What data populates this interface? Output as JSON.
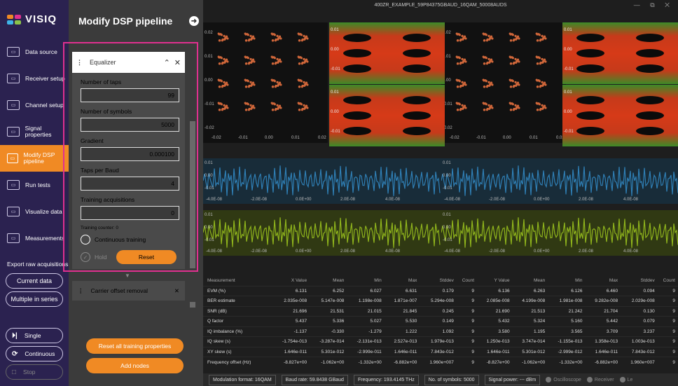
{
  "app": {
    "logo": "VISIQ",
    "window_title": "400ZR_EXAMPLE_59P84375GBAUD_16QAM_50008AUDS"
  },
  "colors": {
    "accent": "#f08a24",
    "nav_bg": "#2b2250",
    "highlight": "#e0308f"
  },
  "nav": {
    "items": [
      {
        "label": "Data source",
        "icon": "data-source-icon"
      },
      {
        "label": "Receiver setup",
        "icon": "receiver-icon"
      },
      {
        "label": "Channel setup",
        "icon": "channel-icon"
      },
      {
        "label": "Signal properties",
        "icon": "signal-icon"
      },
      {
        "label": "Modify DSP pipeline",
        "icon": "dsp-icon"
      },
      {
        "label": "Run tests",
        "icon": "run-tests-icon"
      },
      {
        "label": "Visualize data",
        "icon": "visualize-icon"
      },
      {
        "label": "Measurements",
        "icon": "measurements-icon"
      }
    ],
    "export_label": "Export raw acquisitions",
    "current_data": "Current data",
    "multiple_series": "Multiple in series",
    "single": "Single",
    "continuous": "Continuous",
    "stop": "Stop"
  },
  "panel": {
    "title": "Modify DSP pipeline",
    "equalizer": {
      "title": "Equalizer",
      "fields": [
        {
          "label": "Number of taps",
          "value": "99"
        },
        {
          "label": "Number of symbols",
          "value": "5000"
        },
        {
          "label": "Gradient",
          "value": "0.000100"
        },
        {
          "label": "Taps per Baud",
          "value": "4"
        },
        {
          "label": "Training acquisitions",
          "value": "0"
        }
      ],
      "training_counter": "Training counter: 0",
      "continuous_training": "Continuous training",
      "hold": "Hold",
      "reset": "Reset"
    },
    "carrier": {
      "title": "Carrier offset removal"
    },
    "reset_all": "Reset all training properties",
    "add_nodes": "Add nodes"
  },
  "plots": {
    "const_x_ticks": [
      "-0.02",
      "-0.01",
      "0.00",
      "0.01",
      "0.02"
    ],
    "const_y_ticks": [
      "0.02",
      "0.01",
      "0.00",
      "-0.01",
      "-0.02"
    ],
    "eye_ticks": [
      "0.01",
      "0.00",
      "-0.01"
    ],
    "time_ticks": [
      "-4.0E-08",
      "-2.0E-08",
      "0.0E+00",
      "2.0E-08",
      "4.0E-08"
    ]
  },
  "measurements": {
    "headers": [
      "Measurement",
      "X Value",
      "Mean",
      "Min",
      "Max",
      "Stddev",
      "Count",
      "Y Value",
      "Mean",
      "Min",
      "Max",
      "Stddev",
      "Count"
    ],
    "rows": [
      [
        "EVM (%)",
        "6.131",
        "6.252",
        "6.027",
        "6.631",
        "0.179",
        "9",
        "6.136",
        "6.263",
        "6.126",
        "6.460",
        "0.094",
        "9"
      ],
      [
        "BER estimate",
        "2.035e-008",
        "5.147e-008",
        "1.198e-008",
        "1.871e-007",
        "5.294e-008",
        "9",
        "2.085e-008",
        "4.199e-008",
        "1.981e-008",
        "9.282e-008",
        "2.029e-008",
        "9"
      ],
      [
        "SNR (dB)",
        "21.696",
        "21.531",
        "21.015",
        "21.845",
        "0.245",
        "9",
        "21.690",
        "21.513",
        "21.242",
        "21.704",
        "0.130",
        "9"
      ],
      [
        "Q factor",
        "5.437",
        "5.336",
        "5.027",
        "5.530",
        "0.149",
        "9",
        "5.432",
        "5.324",
        "5.160",
        "5.442",
        "0.079",
        "9"
      ],
      [
        "IQ imbalance (%)",
        "-1.137",
        "-0.330",
        "-1.279",
        "1.222",
        "1.092",
        "9",
        "3.580",
        "1.195",
        "3.565",
        "3.709",
        "3.237",
        "9"
      ],
      [
        "IQ skew (s)",
        "-1.754e-013",
        "-3.287e-014",
        "-2.131e-013",
        "2.527e-013",
        "1.979e-013",
        "9",
        "1.250e-013",
        "3.747e-014",
        "-1.155e-013",
        "1.358e-013",
        "1.003e-013",
        "9"
      ],
      [
        "XY skew (s)",
        "1.646e-011",
        "5.301e-012",
        "-2.999e-011",
        "1.646e-011",
        "7.843e-012",
        "9",
        "1.646e-011",
        "5.301e-012",
        "-2.999e-012",
        "1.646e-011",
        "7.843e-012",
        "9"
      ],
      [
        "Frequency offset (Hz)",
        "-8.827e+00",
        "-1.062e+00",
        "-1.332e+00",
        "-6.882e+00",
        "1.960e+007",
        "9",
        "-8.827e+00",
        "-1.062e+00",
        "-1.332e+00",
        "-6.882e+00",
        "1.960e+007",
        "9"
      ]
    ]
  },
  "status": {
    "modulation": "Modulation format: 16QAM",
    "baud": "Baud rate: 59.8438 GBaud",
    "freq": "Frequency: 193.4145 THz",
    "symbols": "No. of symbols: 5000",
    "power": "Signal power: --- dBm",
    "osc": "Oscilloscope",
    "rx": "Receiver",
    "le": "Le"
  }
}
